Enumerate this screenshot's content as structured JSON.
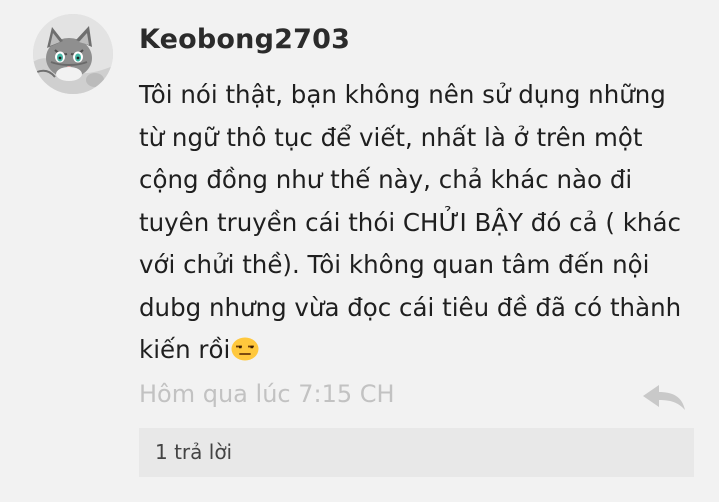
{
  "comment": {
    "author": "Keobong2703",
    "avatar_icon": "kitten-avatar-icon",
    "body_lines": [
      "Tôi nói thật, bạn không nên sử dụng những",
      "từ ngữ thô tục để  viết, nhất là ở trên một",
      "cộng đồng như thế này, chả khác nào đi",
      "tuyên truyền cái thói CHỬI BẬY đó cả ( khác",
      "với chửi thề). Tôi không quan tâm đến nội",
      "dubg nhưng vừa đọc cái tiêu đề đã có thành",
      "kiến rồi"
    ],
    "emoji_icon": "unamused-face-emoji-icon",
    "timestamp": "Hôm qua lúc 7:15 CH",
    "reply_icon": "reply-arrow-icon",
    "replies_label": "1 trả lời"
  }
}
